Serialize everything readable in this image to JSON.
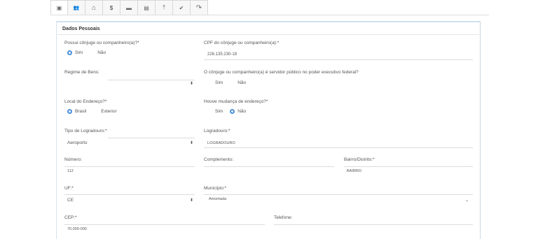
{
  "tabs": [
    {
      "icon": "id-card-icon",
      "glyph": "▣"
    },
    {
      "icon": "users-icon",
      "glyph": "👥"
    },
    {
      "icon": "home-icon",
      "glyph": "⌂"
    },
    {
      "icon": "dollar-icon",
      "glyph": "$"
    },
    {
      "icon": "credit-card-icon",
      "glyph": "▬"
    },
    {
      "icon": "document-icon",
      "glyph": "▤"
    },
    {
      "icon": "upload-icon",
      "glyph": "⤒"
    },
    {
      "icon": "double-check-icon",
      "glyph": "✔"
    },
    {
      "icon": "share-icon",
      "glyph": "↷"
    }
  ],
  "section_title": "Dados Pessoais",
  "fields": {
    "possui_conjuge": {
      "label": "Possui cônjuge ou companheiro(a)?*",
      "opt1": "Sim",
      "opt2": "Não"
    },
    "cpf_conjuge": {
      "label": "CPF do cônjuge ou companheiro(a):*",
      "value": "226.135.230-18"
    },
    "regime_bens": {
      "label": "Regime de Bens:",
      "value": ""
    },
    "servidor_publico": {
      "label": "O cônjuge ou companheiro(a) é servidor público no poder executivo federal?",
      "opt1": "Sim",
      "opt2": "Não"
    },
    "local_endereco": {
      "label": "Local do Endereço?*",
      "opt1": "Brasil",
      "opt2": "Exterior"
    },
    "mudanca_endereco": {
      "label": "Houve mudança de endereço?*",
      "opt1": "Sim",
      "opt2": "Não"
    },
    "tipo_logradouro": {
      "label": "Tipo de Logradouro:*",
      "value": "Aeroporto"
    },
    "logradouro": {
      "label": "Logradouro:*",
      "value": "LOGRADOURO"
    },
    "numero": {
      "label": "Número:",
      "value": "112"
    },
    "complemento": {
      "label": "Complemento:",
      "value": ""
    },
    "bairro": {
      "label": "Bairro/Distrito:*",
      "value": "BAIRRO"
    },
    "uf": {
      "label": "UF:*",
      "value": "CE"
    },
    "municipio": {
      "label": "Município:*",
      "value": "Amontada"
    },
    "cep": {
      "label": "CEP:*",
      "value": "70.000-000"
    },
    "telefone": {
      "label": "Telefone:",
      "value": ""
    }
  },
  "colors": {
    "accent": "#4a90d9",
    "border": "#d7e3ee"
  }
}
